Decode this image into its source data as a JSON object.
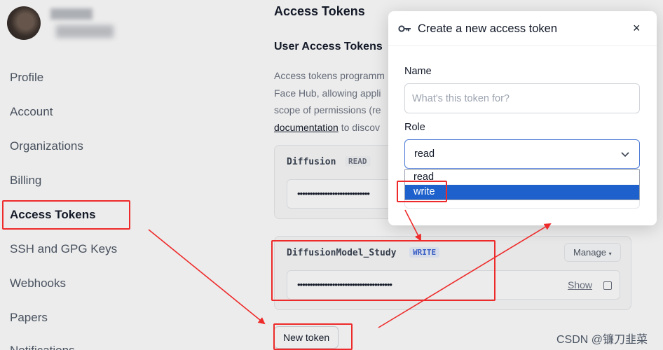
{
  "sidebar": {
    "items": [
      {
        "label": "Profile"
      },
      {
        "label": "Account"
      },
      {
        "label": "Organizations"
      },
      {
        "label": "Billing"
      },
      {
        "label": "Access Tokens"
      },
      {
        "label": "SSH and GPG Keys"
      },
      {
        "label": "Webhooks"
      },
      {
        "label": "Papers"
      },
      {
        "label": "Notifications"
      }
    ]
  },
  "main": {
    "title": "Access Tokens",
    "subtitle": "User Access Tokens",
    "description_lines": [
      "Access tokens programm",
      "Face Hub, allowing appli",
      "scope of permissions (re"
    ],
    "doc_link": "documentation",
    "doc_tail": " to discov",
    "tokens": [
      {
        "name": "Diffusion",
        "role": "READ",
        "masked": "•••••••••••••••••••••••••••••"
      },
      {
        "name": "DiffusionModel_Study",
        "role": "WRITE",
        "masked": "••••••••••••••••••••••••••••••••••••••",
        "manage_label": "Manage",
        "show_label": "Show"
      }
    ],
    "new_token_label": "New token"
  },
  "modal": {
    "title": "Create a new access token",
    "close_label": "×",
    "name_label": "Name",
    "name_placeholder": "What's this token for?",
    "role_label": "Role",
    "role_value": "read",
    "role_options": [
      "read",
      "write"
    ],
    "highlighted_option": "write"
  },
  "watermark": "CSDN @镰刀韭菜",
  "colors": {
    "annotation": "#ee2a2a",
    "select_highlight": "#1e61cc",
    "write_badge": "#3b63d4"
  }
}
